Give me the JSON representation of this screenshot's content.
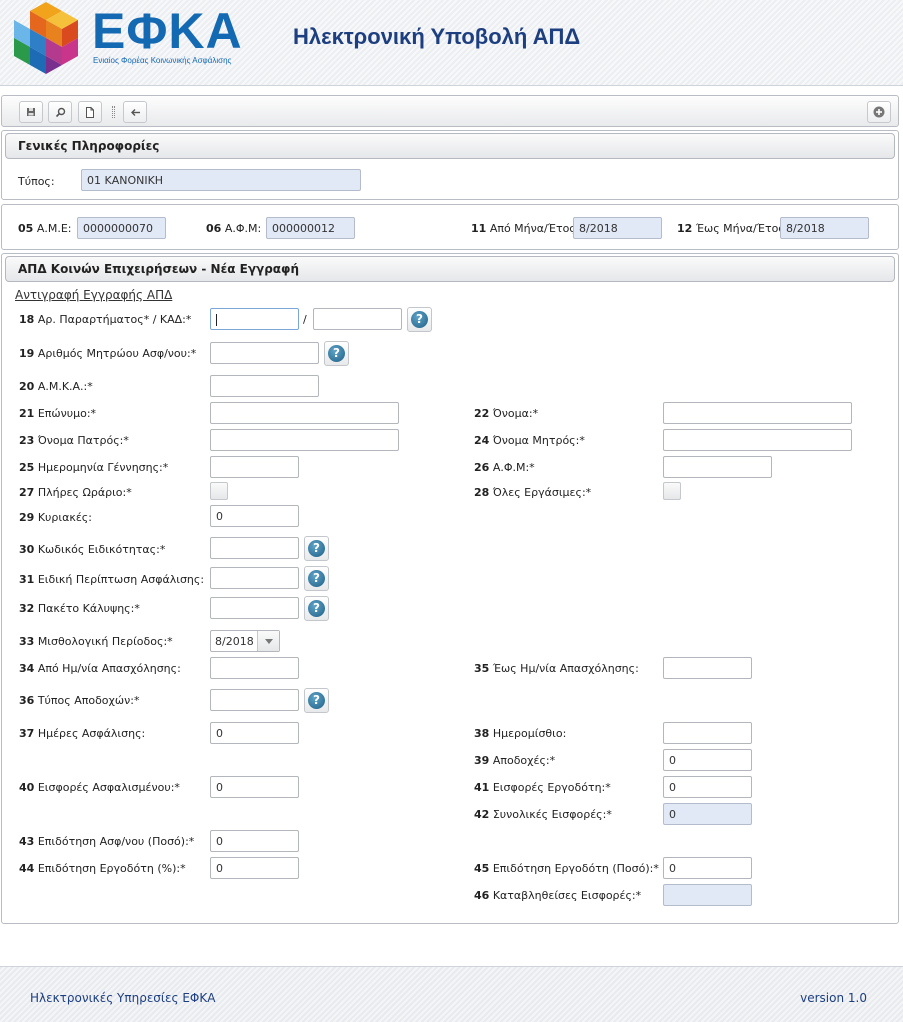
{
  "header": {
    "logo_text": "ΕΦΚΑ",
    "logo_subtitle": "Ενιαίος Φορέας Κοινωνικής Ασφάλισης",
    "app_title": "Ηλεκτρονική Υποβολή ΑΠΔ"
  },
  "colors": {
    "brand_blue": "#1469b3",
    "title_blue": "#1d3f80",
    "readonly_bg": "#e1e9f6"
  },
  "toolbar": {
    "icons": [
      "save-icon",
      "search-icon",
      "new-document-icon",
      "back-arrow-icon",
      "add-circle-icon"
    ]
  },
  "general": {
    "title": "Γενικές Πληροφορίες",
    "type_label": "Τύπος:",
    "type_value": "01 ΚΑΝΟΝΙΚΗ"
  },
  "employer": {
    "ame_num": "05",
    "ame_label": "Α.Μ.Ε:",
    "ame_value": "0000000070",
    "afm_num": "06",
    "afm_label": "Α.Φ.Μ:",
    "afm_value": "000000012",
    "from_num": "11",
    "from_label": "Από Μήνα/Έτος:",
    "from_value": "8/2018",
    "to_num": "12",
    "to_label": "Έως Μήνα/Έτος:",
    "to_value": "8/2018"
  },
  "form": {
    "title": "ΑΠΔ Κοινών Επιχειρήσεων - Νέα Εγγραφή",
    "copy_link": "Αντιγραφή Εγγραφής ΑΠΔ",
    "slash": "/",
    "help_glyph": "?",
    "f18": {
      "num": "18",
      "label": "Αρ. Παραρτήματος* / ΚΑΔ:*"
    },
    "f19": {
      "num": "19",
      "label": "Αριθμός Μητρώου Ασφ/νου:*"
    },
    "f20": {
      "num": "20",
      "label": "Α.Μ.Κ.Α.:*"
    },
    "f21": {
      "num": "21",
      "label": "Επώνυμο:*"
    },
    "f22": {
      "num": "22",
      "label": "Όνομα:*"
    },
    "f23": {
      "num": "23",
      "label": "Όνομα Πατρός:*"
    },
    "f24": {
      "num": "24",
      "label": "Όνομα Μητρός:*"
    },
    "f25": {
      "num": "25",
      "label": "Ημερομηνία Γέννησης:*"
    },
    "f26": {
      "num": "26",
      "label": "Α.Φ.Μ:*"
    },
    "f27": {
      "num": "27",
      "label": "Πλήρες Ωράριο:*"
    },
    "f28": {
      "num": "28",
      "label": "Όλες Εργάσιμες:*"
    },
    "f29": {
      "num": "29",
      "label": "Κυριακές:",
      "value": "0"
    },
    "f30": {
      "num": "30",
      "label": "Κωδικός Ειδικότητας:*"
    },
    "f31": {
      "num": "31",
      "label": "Ειδική Περίπτωση Ασφάλισης:"
    },
    "f32": {
      "num": "32",
      "label": "Πακέτο Κάλυψης:*"
    },
    "f33": {
      "num": "33",
      "label": "Μισθολογική Περίοδος:*",
      "value": "8/2018"
    },
    "f34": {
      "num": "34",
      "label": "Από Ημ/νία Απασχόλησης:"
    },
    "f35": {
      "num": "35",
      "label": "Έως Ημ/νία Απασχόλησης:"
    },
    "f36": {
      "num": "36",
      "label": "Τύπος Αποδοχών:*"
    },
    "f37": {
      "num": "37",
      "label": "Ημέρες Ασφάλισης:",
      "value": "0"
    },
    "f38": {
      "num": "38",
      "label": "Ημερομίσθιο:"
    },
    "f39": {
      "num": "39",
      "label": "Αποδοχές:*",
      "value": "0"
    },
    "f40": {
      "num": "40",
      "label": "Εισφορές Ασφαλισμένου:*",
      "value": "0"
    },
    "f41": {
      "num": "41",
      "label": "Εισφορές Εργοδότη:*",
      "value": "0"
    },
    "f42": {
      "num": "42",
      "label": "Συνολικές Εισφορές:*",
      "value": "0"
    },
    "f43": {
      "num": "43",
      "label": "Επιδότηση Ασφ/νου (Ποσό):*",
      "value": "0"
    },
    "f44": {
      "num": "44",
      "label": "Επιδότηση Εργοδότη (%):*",
      "value": "0"
    },
    "f45": {
      "num": "45",
      "label": "Επιδότηση Εργοδότη (Ποσό):*",
      "value": "0"
    },
    "f46": {
      "num": "46",
      "label": "Καταβληθείσες Εισφορές:*"
    }
  },
  "footer": {
    "left": "Ηλεκτρονικές Υπηρεσίες ΕΦΚΑ",
    "right": "version 1.0"
  }
}
